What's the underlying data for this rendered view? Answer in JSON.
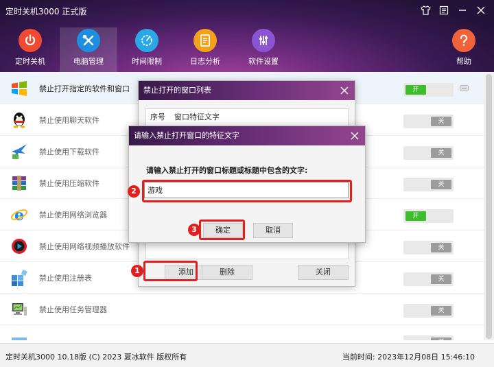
{
  "app": {
    "title": "定时关机3000 正式版"
  },
  "nav": {
    "items": [
      {
        "label": "定时关机",
        "color": "#f04a32"
      },
      {
        "label": "电脑管理",
        "color": "#1e8fe0"
      },
      {
        "label": "时间限制",
        "color": "#2aa7e6"
      },
      {
        "label": "日志分析",
        "color": "#f1a21a"
      },
      {
        "label": "软件设置",
        "color": "#8a54d3"
      },
      {
        "label": "帮助",
        "color": "#f0623a"
      }
    ],
    "active_index": 1
  },
  "list": {
    "rows": [
      {
        "label": "禁止打开指定的软件和窗口",
        "state": "开",
        "on": true,
        "icon": "windows-logo-icon"
      },
      {
        "label": "禁止使用聊天软件",
        "state": "关",
        "on": false,
        "icon": "qq-penguin-icon"
      },
      {
        "label": "禁止使用下载软件",
        "state": "关",
        "on": false,
        "icon": "bird-download-icon"
      },
      {
        "label": "禁止使用压缩软件",
        "state": "关",
        "on": false,
        "icon": "winrar-books-icon"
      },
      {
        "label": "禁止使用网络浏览器",
        "state": "开",
        "on": true,
        "icon": "ie-browser-icon"
      },
      {
        "label": "禁止使用网络视频播放软件",
        "state": "关",
        "on": false,
        "icon": "video-player-icon"
      },
      {
        "label": "禁止使用注册表",
        "state": "关",
        "on": false,
        "icon": "registry-cubes-icon"
      },
      {
        "label": "禁止使用任务管理器",
        "state": "关",
        "on": false,
        "icon": "computer-monitor-icon"
      },
      {
        "label": "",
        "state": "关",
        "on": false,
        "icon": "partial-row-icon"
      }
    ]
  },
  "list_dialog": {
    "title": "禁止打开的窗口列表",
    "columns": [
      "序号",
      "窗口特征文字"
    ],
    "buttons": {
      "add": "添加",
      "delete": "删除",
      "close": "关闭"
    }
  },
  "input_dialog": {
    "title": "请输入禁止打开窗口的特征文字",
    "prompt": "请输入禁止打开的窗口标题或标题中包含的文字:",
    "value": "游戏",
    "ok": "确定",
    "cancel": "取消"
  },
  "status": {
    "left": "定时关机3000 10.18版 (C) 2023  夏冰软件 版权所有",
    "right": "当前时间:  2023年12月08日 15:46:10"
  },
  "annotations": [
    "1",
    "2",
    "3"
  ],
  "colors": {
    "highlight": "#e0201e",
    "toggle_on": "#3fbe2d",
    "toggle_off": "#9c9c9c"
  }
}
